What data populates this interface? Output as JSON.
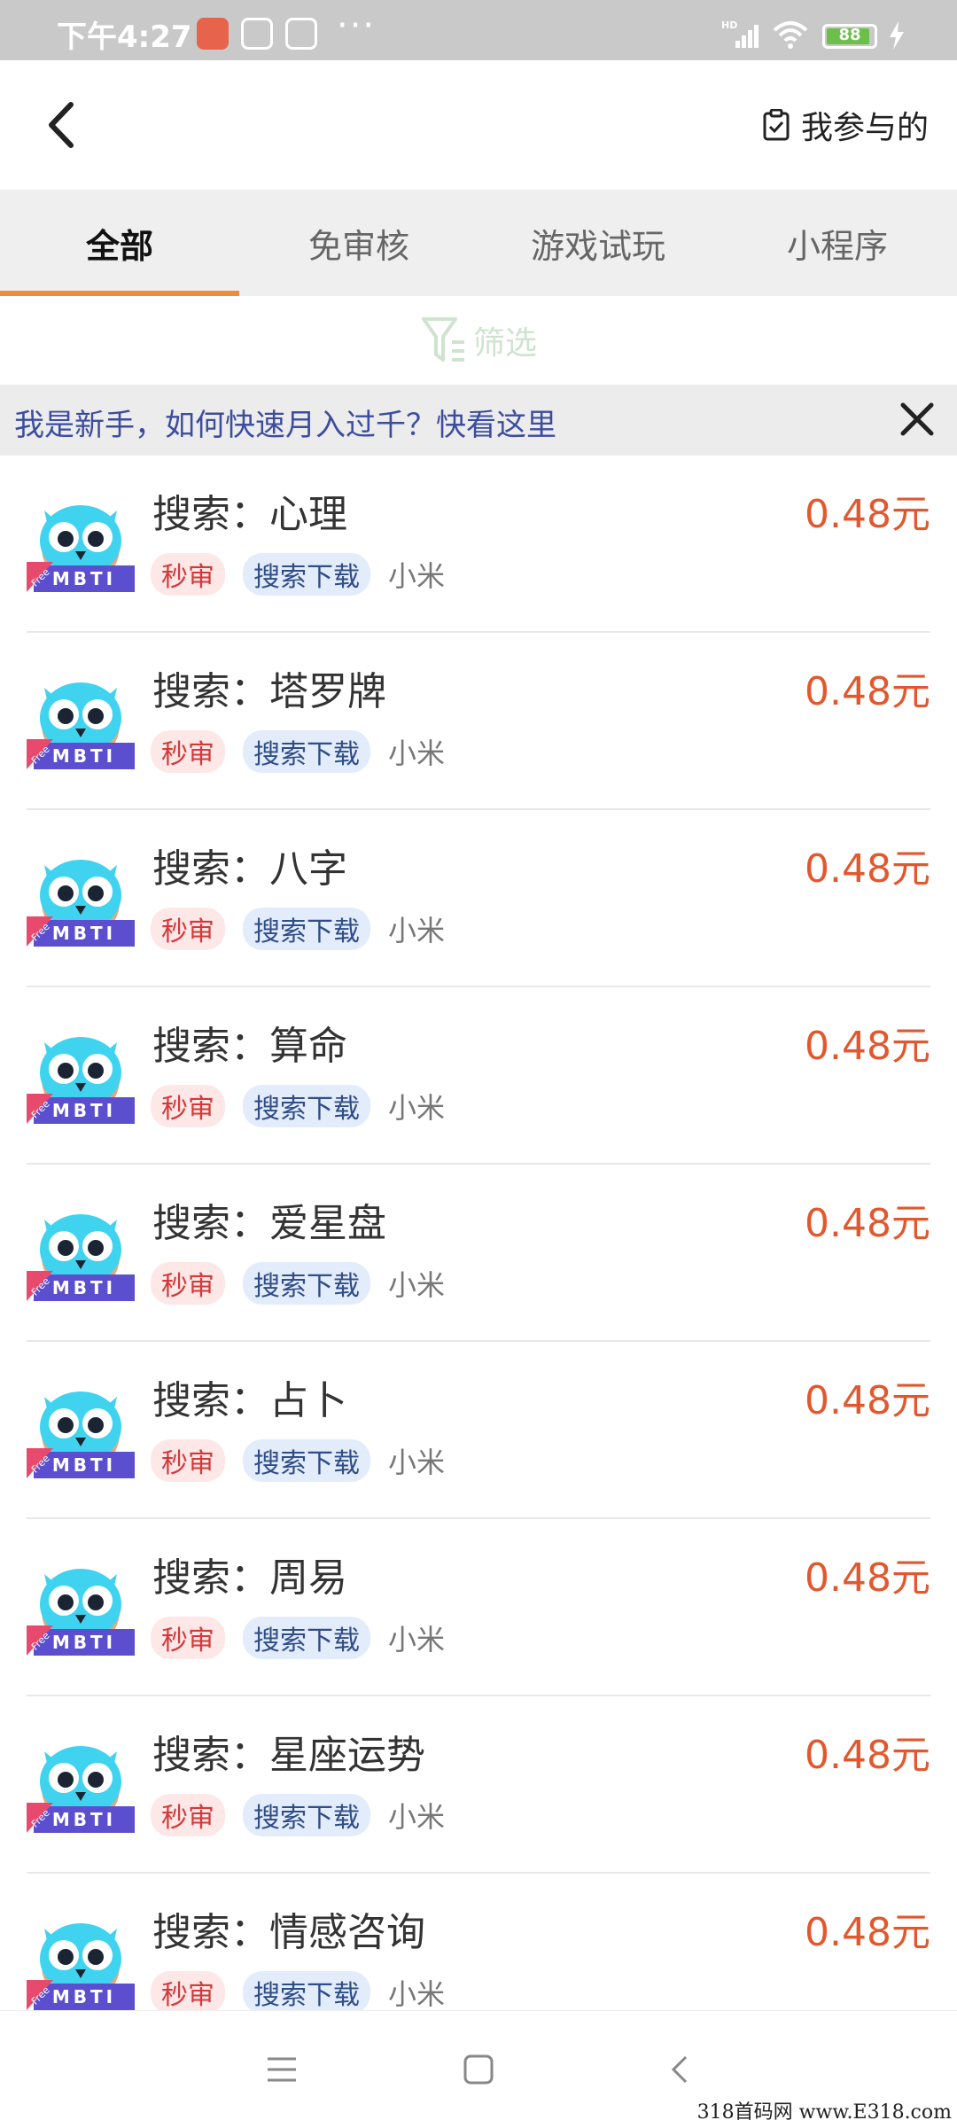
{
  "status_bar": {
    "time": "下午4:27",
    "battery": "88",
    "network": "HD",
    "more": "···"
  },
  "header": {
    "mine_label": "我参与的"
  },
  "tabs": [
    {
      "label": "全部",
      "active": true
    },
    {
      "label": "免审核",
      "active": false
    },
    {
      "label": "游戏试玩",
      "active": false
    },
    {
      "label": "小程序",
      "active": false
    }
  ],
  "filter": {
    "label": "筛选"
  },
  "notice": {
    "text": "我是新手，如何快速月入过千？快看这里"
  },
  "tasks": [
    {
      "title": "搜索：心理",
      "price": "0.48元",
      "tag1": "秒审",
      "tag2": "搜索下载",
      "platform": "小米"
    },
    {
      "title": "搜索：塔罗牌",
      "price": "0.48元",
      "tag1": "秒审",
      "tag2": "搜索下载",
      "platform": "小米"
    },
    {
      "title": "搜索：八字",
      "price": "0.48元",
      "tag1": "秒审",
      "tag2": "搜索下载",
      "platform": "小米"
    },
    {
      "title": "搜索：算命",
      "price": "0.48元",
      "tag1": "秒审",
      "tag2": "搜索下载",
      "platform": "小米"
    },
    {
      "title": "搜索：爱星盘",
      "price": "0.48元",
      "tag1": "秒审",
      "tag2": "搜索下载",
      "platform": "小米"
    },
    {
      "title": "搜索：占卜",
      "price": "0.48元",
      "tag1": "秒审",
      "tag2": "搜索下载",
      "platform": "小米"
    },
    {
      "title": "搜索：周易",
      "price": "0.48元",
      "tag1": "秒审",
      "tag2": "搜索下载",
      "platform": "小米"
    },
    {
      "title": "搜索：星座运势",
      "price": "0.48元",
      "tag1": "秒审",
      "tag2": "搜索下载",
      "platform": "小米"
    },
    {
      "title": "搜索：情感咨询",
      "price": "0.48元",
      "tag1": "秒审",
      "tag2": "搜索下载",
      "platform": "小米"
    }
  ],
  "icon_text": {
    "badge": "MBTI",
    "ribbon": "Free"
  },
  "watermark": "318首码网 www.E318.com",
  "colors": {
    "price": "#e2582e",
    "tab_indicator": "#f08b3a",
    "notice_text": "#3c4d9e",
    "tag_red_bg": "#fde7e7",
    "tag_blue_bg": "#e3ecfb"
  }
}
